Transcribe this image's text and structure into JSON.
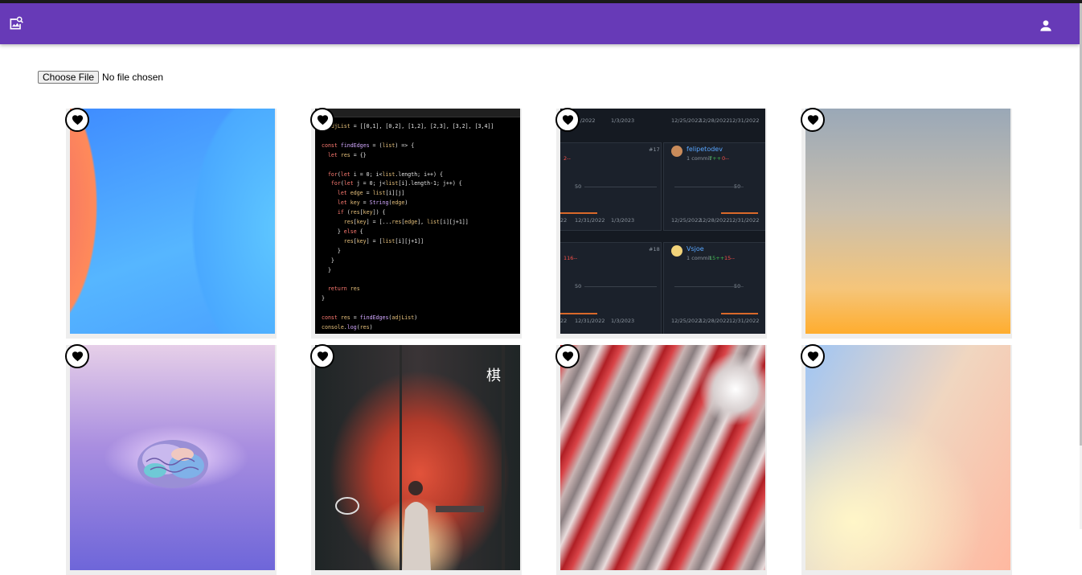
{
  "header": {
    "logo_icon": "image-search-icon",
    "account_icon": "person-icon",
    "background_color": "#673ab7"
  },
  "upload": {
    "button_label": "Choose File",
    "status_text": "No file chosen"
  },
  "gallery": {
    "favorite_icon": "heart-icon",
    "images": [
      {
        "description": "abstract blue gradient"
      },
      {
        "description": "code editor screenshot"
      },
      {
        "description": "commit activity dashboard"
      },
      {
        "description": "grey to orange gradient"
      },
      {
        "description": "glowing brain"
      },
      {
        "description": "illustration woman by window"
      },
      {
        "description": "red and white marble texture"
      },
      {
        "description": "pastel gradient"
      }
    ]
  },
  "code_image": {
    "lines": [
      "t adjList = [[0,1], [0,2], [1,2], [2,3], [3,2], [3,4]]",
      "",
      "const findEdges = (list) => {",
      "  let res = {}",
      "",
      "  for(let i = 0; i<list.length; i++) {",
      "   for(let j = 0; j<list[i].length-1; j++) {",
      "     let edge = list[i][j]",
      "     let key = String(edge)",
      "     if (res[key]) {",
      "       res[key] = [...res[edge], list[i][j+1]]",
      "     } else {",
      "       res[key] = [list[i][j+1]]",
      "     }",
      "   }",
      "  }",
      "",
      "  return res",
      "}",
      "",
      "const res = findEdges(adjList)",
      "console.log(res)"
    ]
  },
  "dashboard_image": {
    "dates_top": [
      "12/31/2022",
      "1/3/2023",
      "12/25/2022",
      "12/28/2022",
      "12/31/2022"
    ],
    "user1": "felipetodev",
    "user1_meta": "1 commit",
    "user1_adds": "7++",
    "user1_dels": "0--",
    "user1_rank": "#17",
    "user2": "Vsjoe",
    "user2_meta": "1 commit",
    "user2_adds": "15++",
    "user2_dels": "15--",
    "user2_rank": "#18",
    "left1_dels": "2--",
    "left2_dels": "116--",
    "y_tick": "50",
    "date_a": "22",
    "date_b": "12/31/2022",
    "date_c": "1/3/2023",
    "date_d": "12/25/2022",
    "date_e": "12/28/2022",
    "date_f": "12/31/2022"
  },
  "artwork_text": "棋"
}
